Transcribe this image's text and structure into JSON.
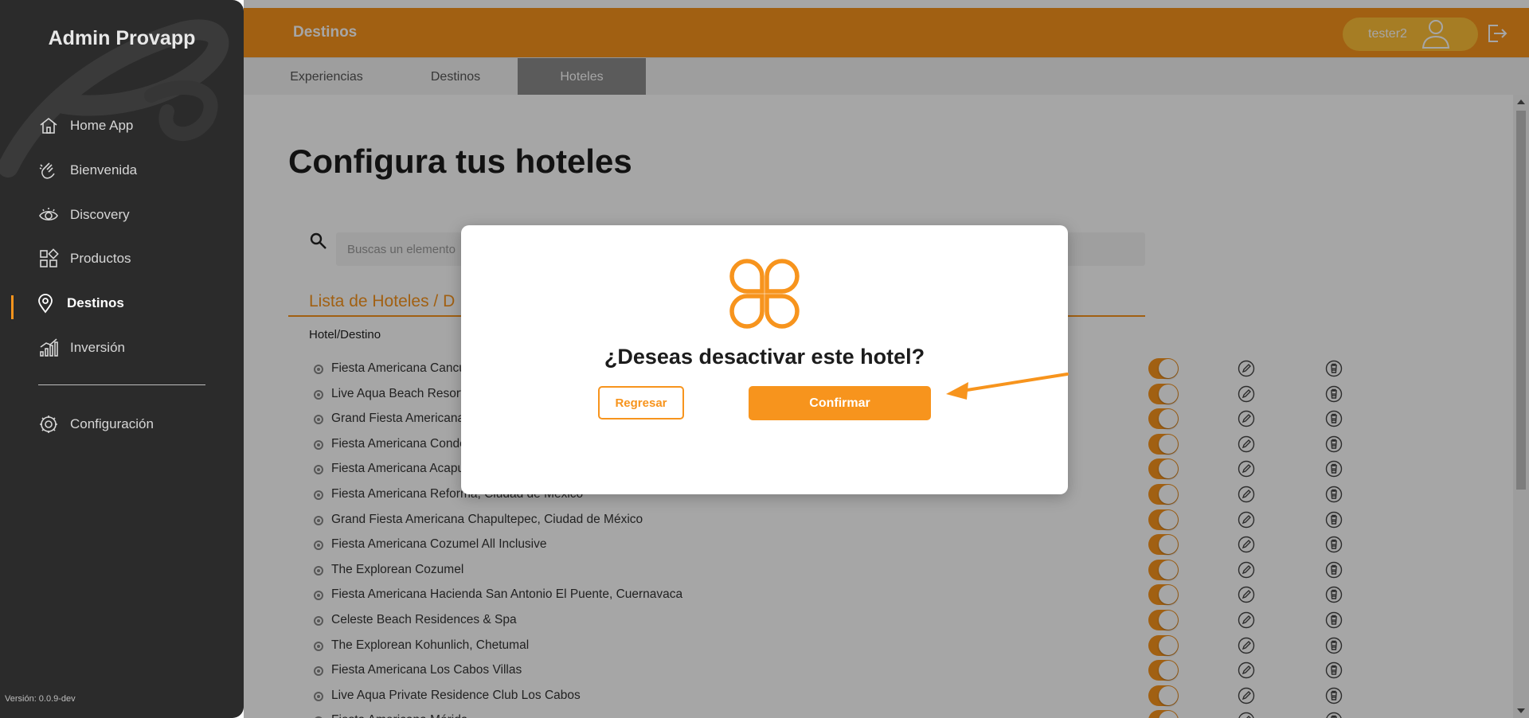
{
  "sidebar": {
    "brand": "Admin Provapp",
    "items": [
      {
        "label": "Home App",
        "icon": "home-icon"
      },
      {
        "label": "Bienvenida",
        "icon": "wave-hand-icon"
      },
      {
        "label": "Discovery",
        "icon": "eye-icon"
      },
      {
        "label": "Productos",
        "icon": "grid-icon"
      },
      {
        "label": "Destinos",
        "icon": "map-pin-icon",
        "active": true
      },
      {
        "label": "Inversión",
        "icon": "bar-chart-icon"
      }
    ],
    "settings": {
      "label": "Configuración",
      "icon": "gear-icon"
    },
    "version": "Versión: 0.0.9-dev"
  },
  "header": {
    "title": "Destinos",
    "user": "tester2"
  },
  "tabs": [
    {
      "label": "Experiencias"
    },
    {
      "label": "Destinos"
    },
    {
      "label": "Hoteles",
      "active": true
    }
  ],
  "main": {
    "page_title": "Configura tus hoteles",
    "search_placeholder": "Buscas un elemento",
    "list_title": "Lista de Hoteles / D",
    "column_header": "Hotel/Destino",
    "hotels": [
      {
        "name": "Fiesta Americana Cancú",
        "active": true
      },
      {
        "name": "Live Aqua Beach Resort",
        "active": true
      },
      {
        "name": "Grand Fiesta Americana",
        "active": true
      },
      {
        "name": "Fiesta Americana Conde",
        "active": true
      },
      {
        "name": "Fiesta Americana Acapu",
        "active": true
      },
      {
        "name": "Fiesta Americana Reforma, Ciudad de México",
        "active": true
      },
      {
        "name": "Grand Fiesta Americana Chapultepec, Ciudad de México",
        "active": true
      },
      {
        "name": "Fiesta Americana Cozumel All Inclusive",
        "active": true
      },
      {
        "name": "The Explorean Cozumel",
        "active": true
      },
      {
        "name": "Fiesta Americana Hacienda San Antonio El Puente, Cuernavaca",
        "active": true
      },
      {
        "name": "Celeste Beach Residences & Spa",
        "active": true
      },
      {
        "name": "The Explorean Kohunlich, Chetumal",
        "active": true
      },
      {
        "name": "Fiesta Americana Los Cabos Villas",
        "active": true
      },
      {
        "name": "Live Aqua Private Residence Club Los Cabos",
        "active": true
      },
      {
        "name": "Fiesta Americana Mérida",
        "active": true
      }
    ]
  },
  "modal": {
    "question": "¿Deseas desactivar este hotel?",
    "back_label": "Regresar",
    "confirm_label": "Confirmar"
  },
  "colors": {
    "accent": "#f7941d",
    "sidebar": "#2b2b2b",
    "user_pill": "#ffc038"
  }
}
